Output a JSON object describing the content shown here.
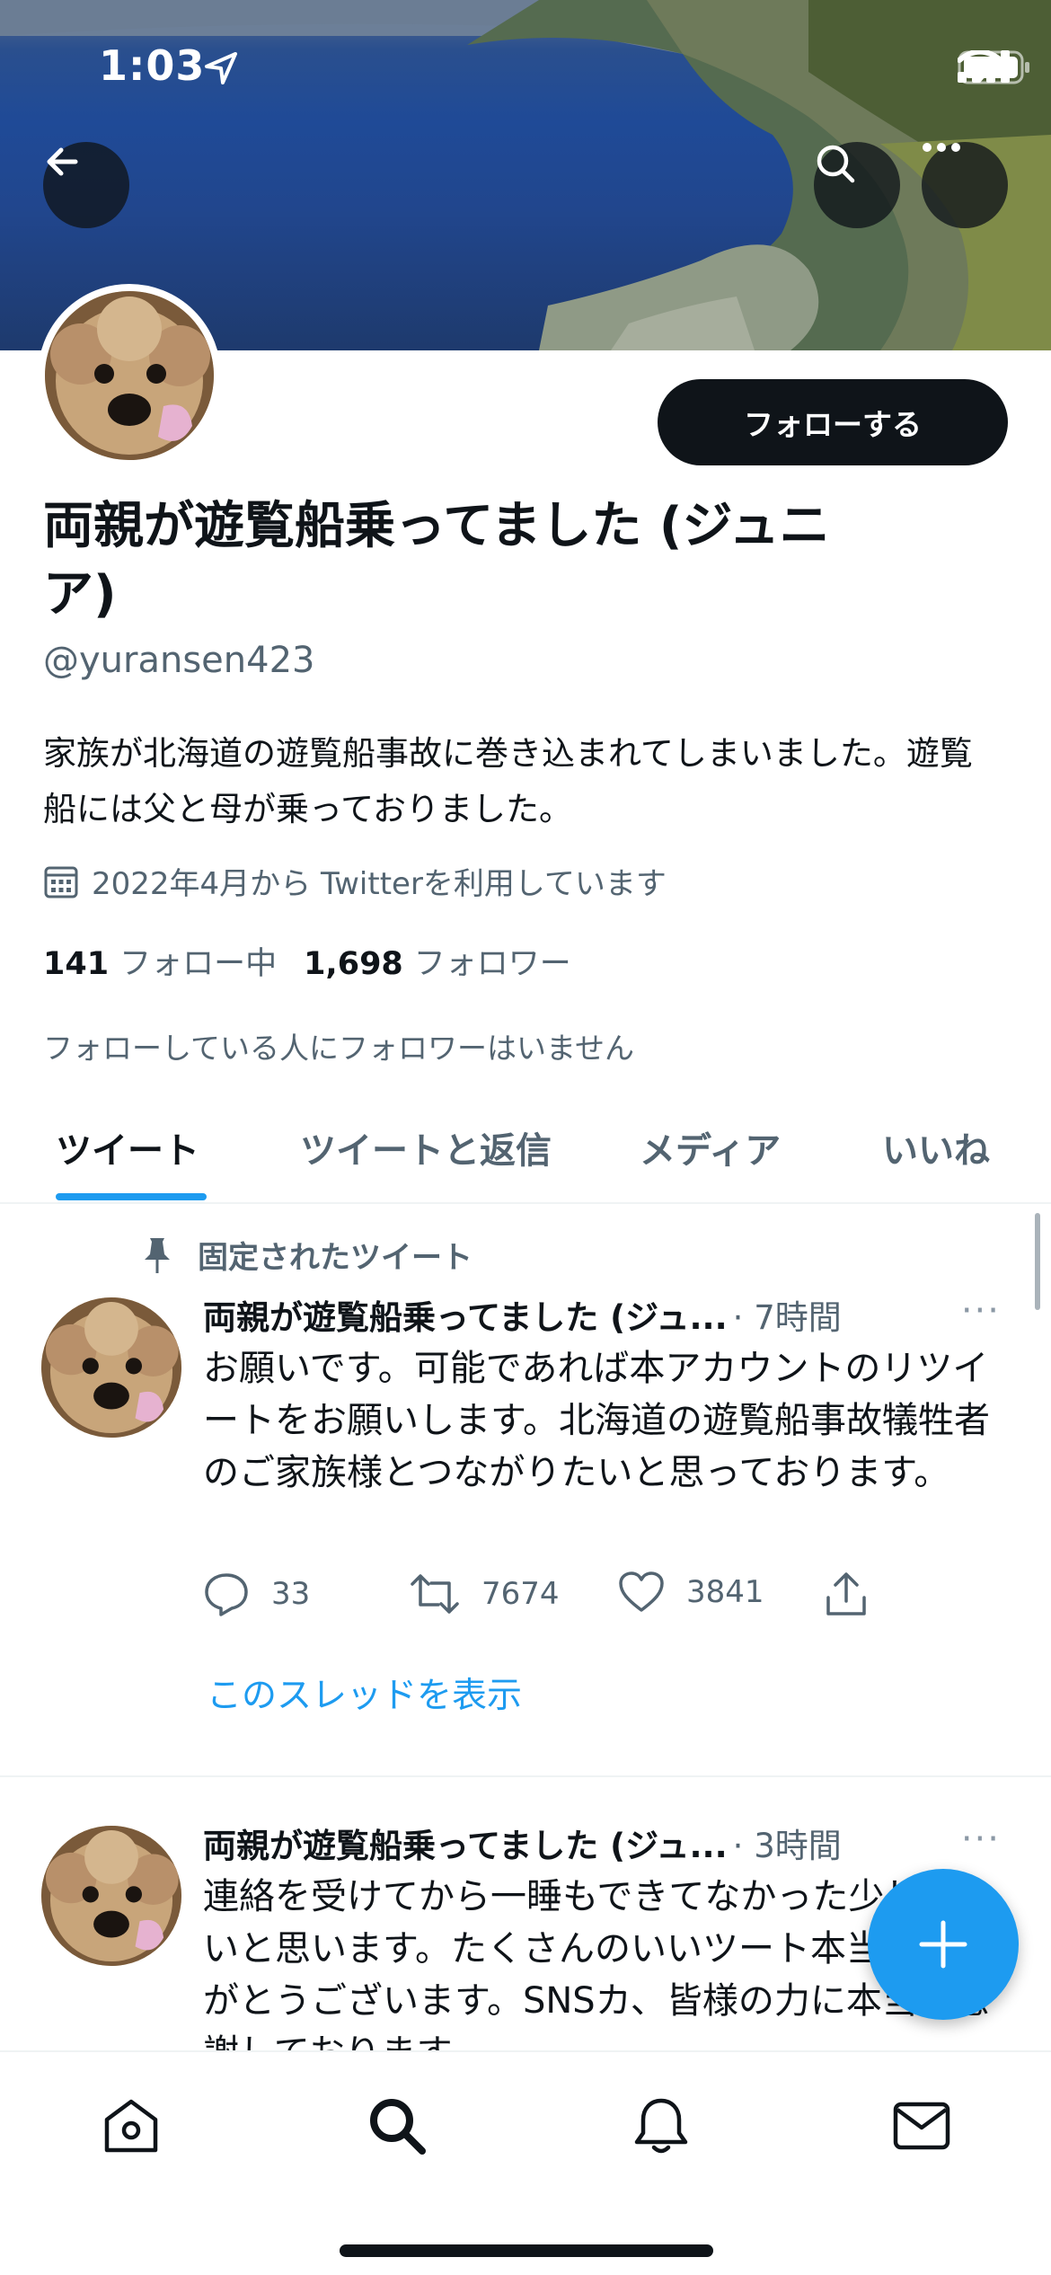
{
  "status_bar": {
    "time": "1:03"
  },
  "profile": {
    "follow_label": "フォローする",
    "display_name": "両親が遊覧船乗ってました (ジュニア)",
    "handle": "@yuransen423",
    "bio": "家族が北海道の遊覧船事故に巻き込まれてしまいました。遊覧船には父と母が乗っておりました。",
    "joined": "2022年4月から Twitterを利用しています",
    "following_count": "141",
    "following_label": "フォロー中",
    "followers_count": "1,698",
    "followers_label": "フォロワー",
    "followers_note": "フォローしている人にフォロワーはいません"
  },
  "tabs": [
    {
      "label": "ツイート",
      "active": true
    },
    {
      "label": "ツイートと返信",
      "active": false
    },
    {
      "label": "メディア",
      "active": false
    },
    {
      "label": "いいね",
      "active": false
    }
  ],
  "tweets": [
    {
      "pinned_label": "固定されたツイート",
      "name": "両親が遊覧船乗ってました (ジュ...",
      "time": "· 7時間",
      "more": "···",
      "text": "お願いです。可能であれば本アカウントのリツイートをお願いします。北海道の遊覧船事故犠牲者のご家族様とつながりたいと思っております。",
      "replies": "33",
      "retweets": "7674",
      "likes": "3841",
      "show_thread": "このスレッドを表示"
    },
    {
      "name": "両親が遊覧船乗ってました (ジュ...",
      "time": "· 3時間",
      "more": "···",
      "text": "連絡を受けてから一睡もできてなかった少し寝たいと思います。たくさんのいいツート本当にありがとうございます。SNSカ、皆様の力に本当に感謝しております"
    }
  ],
  "colors": {
    "accent": "#1d9bf0",
    "text": "#0f1419",
    "secondary": "#536471"
  }
}
